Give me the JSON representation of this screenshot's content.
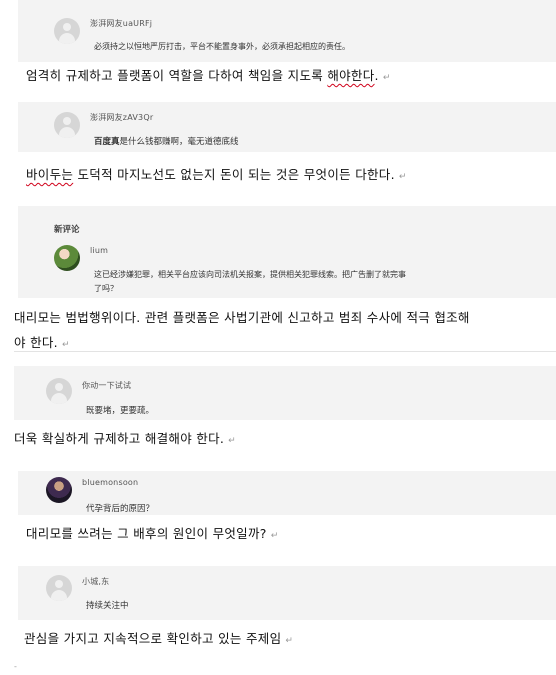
{
  "blocks": [
    {
      "user": "澎湃网友uaURFj",
      "comment": "必须持之以恒地严厉打击，平台不能置身事外，必须承担起相应的责任。",
      "translation_parts": [
        "엄격히 규제하고 플랫폼이 역할을 다하여 책임을 지도록 ",
        "해야한다",
        "."
      ]
    },
    {
      "user": "澎湃网友zAV3Qr",
      "comment_lead": "百度真",
      "comment_rest": "是什么钱都赚啊，毫无道德底线",
      "translation_parts": [
        "",
        "바이두는",
        " 도덕적 마지노선도 없는지 돈이 되는 것은 무엇이든 다한다."
      ]
    },
    {
      "section_label": "新评论",
      "user": "lium",
      "comment_line1": "这已经涉嫌犯罪，相关平台应该向司法机关报案，提供相关犯罪线索。把广告删了就完事",
      "comment_line2": "了吗？",
      "translation_line1": "대리모는 범법행위이다. 관련 플랫폼은 사법기관에 신고하고 범죄 수사에 적극 협조해",
      "translation_line2": "야 한다."
    },
    {
      "user": "你动一下试试",
      "comment": "既要堵，更要疏。",
      "translation": "더욱 확실하게 규제하고 해결해야 한다."
    },
    {
      "user": "bluemonsoon",
      "comment": "代孕背后的原因？",
      "translation": "대리모를 쓰려는 그 배후의 원인이 무엇일까?"
    },
    {
      "user": "小城,东",
      "comment": "持续关注中",
      "translation": "관심을 가지고 지속적으로 확인하고 있는 주제임"
    }
  ],
  "paragraph_mark": "↵",
  "footer_mark": "-"
}
